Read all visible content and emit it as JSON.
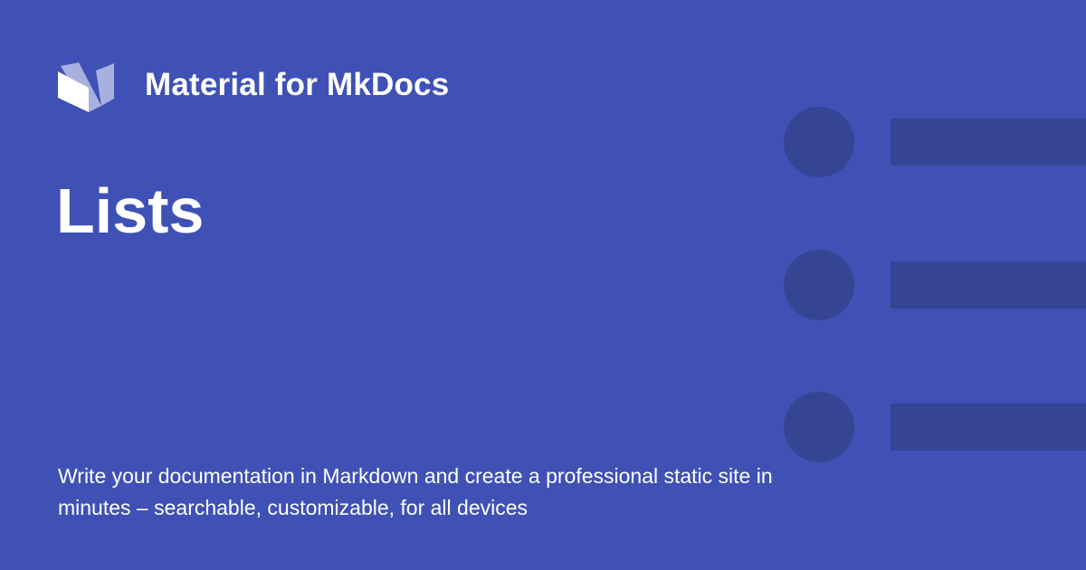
{
  "brand": {
    "site_name": "Material for MkDocs",
    "logo_icon": "material-mkdocs-logo-icon"
  },
  "page": {
    "title": "Lists",
    "description": "Write your documentation in Markdown and create a professional static site in minutes – searchable, customizable, for all devices"
  },
  "illustration": {
    "icon": "format-list-bulleted-icon",
    "items": 3
  },
  "colors": {
    "background": "#3f51b5",
    "foreground": "#ffffff",
    "illustration": "#354493"
  }
}
